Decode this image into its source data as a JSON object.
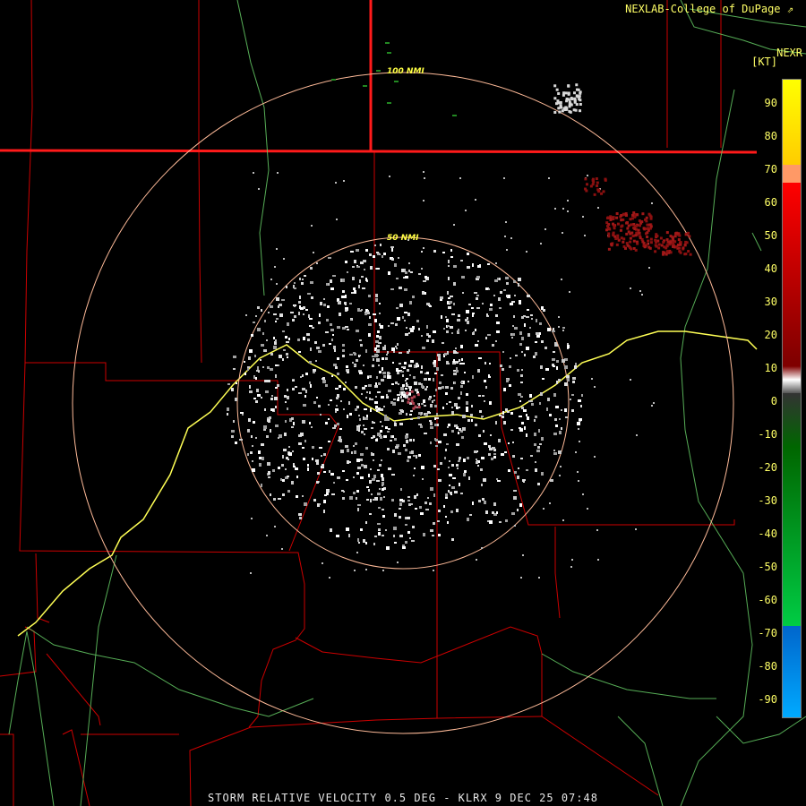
{
  "header": {
    "credit": "NEXLAB-College of DuPage",
    "credit_icon": "arrow-icon",
    "product": "NEXR",
    "unit": "[KT]"
  },
  "footer": {
    "text": "STORM RELATIVE VELOCITY 0.5 DEG - KLRX 9 DEC 25 07:48"
  },
  "range_rings": [
    "100 NMI",
    "50 NMI"
  ],
  "scale": {
    "labels": [
      "90",
      "80",
      "70",
      "60",
      "50",
      "40",
      "30",
      "20",
      "10",
      "0",
      "-10",
      "-20",
      "-30",
      "-40",
      "-50",
      "-60",
      "-70",
      "-80",
      "-90"
    ],
    "colors": {
      "yellow": "#ffff00",
      "orange": "#ff9966",
      "red": "#ff0000",
      "dark_red": "#800000",
      "gray": "#aaaaaa",
      "dark_green": "#006600",
      "green": "#00cc44",
      "blue": "#0066cc",
      "cyan": "#00aaff"
    }
  },
  "map_colors": {
    "county_lines": "#cc0000",
    "state_lines": "#ff0000",
    "highways": "#66cc66",
    "interstate": "#ffff66",
    "range_rings": "#ffbb99"
  }
}
